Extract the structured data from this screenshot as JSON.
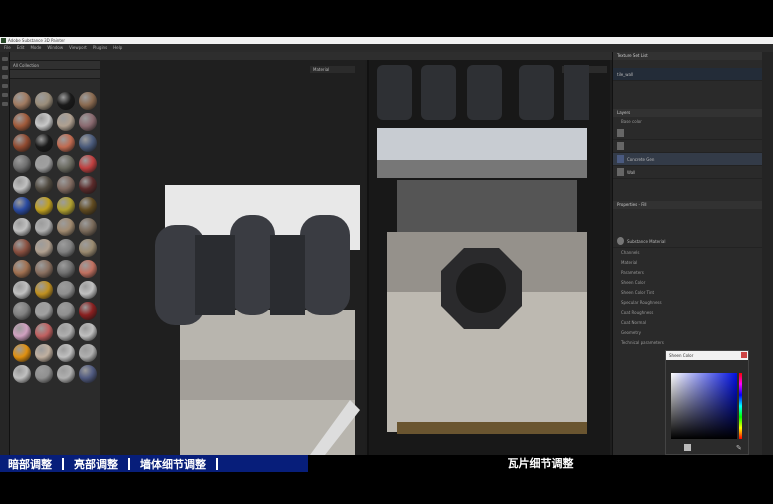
{
  "window": {
    "title": "Adobe Substance 3D Painter"
  },
  "menu": [
    "File",
    "Edit",
    "Mode",
    "Window",
    "Viewport",
    "Plugins",
    "Help"
  ],
  "shelf": {
    "search": "",
    "breadcrumb": "All Collection"
  },
  "materials": [
    "#a07a60",
    "#9a8d7a",
    "#1a1a1a",
    "#8a6a50",
    "#a05a3a",
    "#c8c8c8",
    "#b0a090",
    "#8a6a70",
    "#904a30",
    "#1a1a1a",
    "#c06a50",
    "#4a5a7a",
    "#707070",
    "#a0a0a0",
    "#6a6a60",
    "#c04040",
    "#c0c0c0",
    "#504a40",
    "#806a60",
    "#5a2a2a",
    "#2a4aa0",
    "#c0a020",
    "#b0a030",
    "#604a20",
    "#c0c0c0",
    "#b0b0b0",
    "#a08a70",
    "#7a6a5a",
    "#8a5040",
    "#b0a090",
    "#808080",
    "#9a8a70",
    "#a07050",
    "#8a7060",
    "#707070",
    "#c07060",
    "#c0c0c0",
    "#c09020",
    "#909090",
    "#c0c0c0",
    "#808080",
    "#a0a0a0",
    "#909090",
    "#8a2020",
    "#d0a0c0",
    "#c06060",
    "#b0b0b0",
    "#c0c0c0",
    "#e09010",
    "#c0b0a0",
    "#c0c0c0",
    "#b0b0b0",
    "#c0c0c0",
    "#909090",
    "#b0b0b0",
    "#505a80"
  ],
  "viewport3d": {
    "channel": "Material"
  },
  "viewport2d": {
    "channel": "Material"
  },
  "texture_set": {
    "panel": "Texture Set List",
    "item": "tile_wall"
  },
  "layers": {
    "tab": "Layers",
    "blend": "Base color",
    "items": [
      "",
      "",
      "Concrete Gen",
      "Wall"
    ]
  },
  "properties": {
    "panel": "Properties - Fill",
    "material": "Substance Material",
    "sections": [
      "Channels",
      "Material",
      "Parameters"
    ],
    "params": [
      "Sheen Color",
      "Sheen Color Tint",
      "Specular Roughness",
      "Coat Roughness",
      "Coat Normal",
      "Geometry",
      "Technical parameters"
    ]
  },
  "color_picker": {
    "title": "Sheen Color",
    "hue_color": "#0010e0"
  },
  "caption": {
    "segments": [
      "暗部调整",
      "亮部调整",
      "墙体细节调整"
    ],
    "main": "瓦片细节调整"
  }
}
